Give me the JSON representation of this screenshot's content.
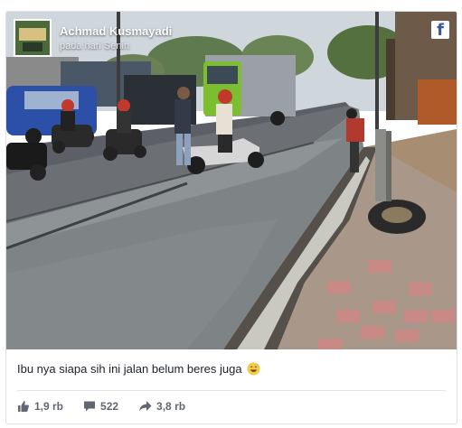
{
  "post": {
    "author": "Achmad Kusmayadi",
    "timestamp": "pada hari Senin",
    "caption": "Ibu nya siapa sih ini jalan belum beres juga",
    "caption_emoji": "grinning-sweat-emoji",
    "platform_icon": "facebook-icon"
  },
  "stats": {
    "likes": "1,9 rb",
    "comments": "522",
    "shares": "3,8 rb"
  },
  "colors": {
    "text": "#1d2129",
    "muted": "#606770",
    "facebook": "#3b5998"
  }
}
